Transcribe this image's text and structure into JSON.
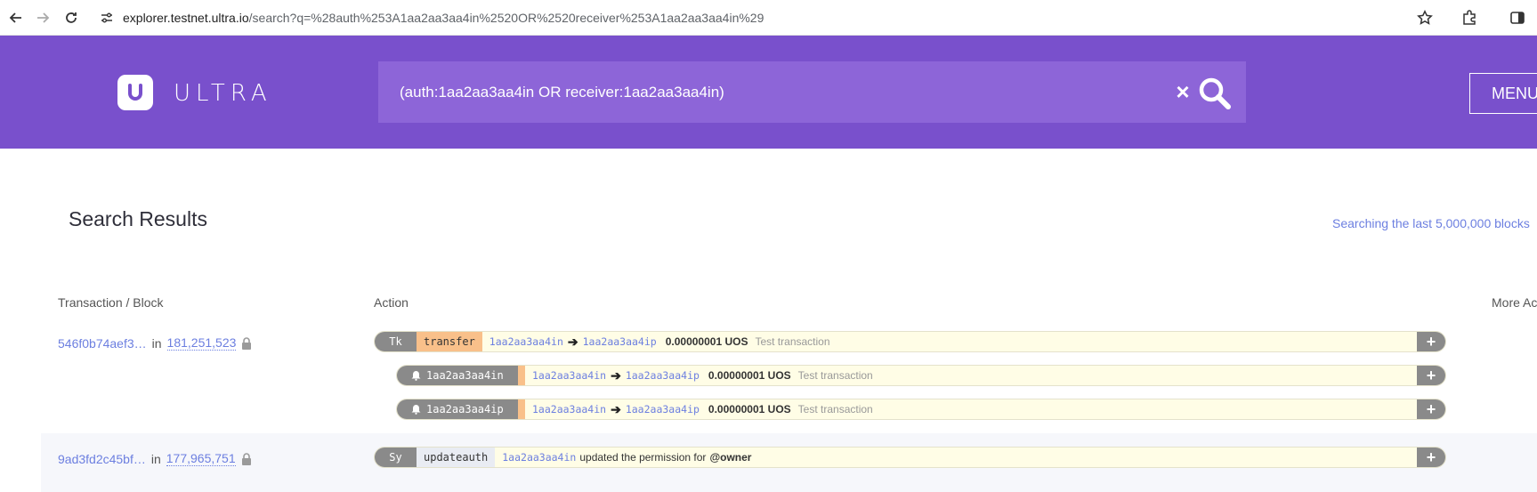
{
  "browser": {
    "url_host": "explorer.testnet.ultra.io",
    "url_path": "/search?q=%28auth%253A1aa2aa3aa4in%2520OR%2520receiver%253A1aa2aa3aa4in%29"
  },
  "header": {
    "logo_text": "ULTRA",
    "search_value": "(auth:1aa2aa3aa4in OR receiver:1aa2aa3aa4in)",
    "clear_symbol": "×",
    "menu_label": "MENU"
  },
  "results": {
    "title": "Search Results",
    "searching_text": "Searching the last 5,000,000 blocks",
    "columns": {
      "tx_block": "Transaction / Block",
      "action": "Action",
      "more": "More Ac"
    },
    "rows": [
      {
        "tx": "546f0b74aef3…",
        "in": "in",
        "block": "181,251,523",
        "actions": [
          {
            "code": "Tk",
            "name": "transfer",
            "from": "1aa2aa3aa4in",
            "to": "1aa2aa3aa4ip",
            "amount": "0.00000001 UOS",
            "memo": "Test transaction"
          },
          {
            "notify": "1aa2aa3aa4in",
            "from": "1aa2aa3aa4in",
            "to": "1aa2aa3aa4ip",
            "amount": "0.00000001 UOS",
            "memo": "Test transaction"
          },
          {
            "notify": "1aa2aa3aa4ip",
            "from": "1aa2aa3aa4in",
            "to": "1aa2aa3aa4ip",
            "amount": "0.00000001 UOS",
            "memo": "Test transaction"
          }
        ]
      },
      {
        "tx": "9ad3fd2c45bf…",
        "in": "in",
        "block": "177,965,751",
        "actions": [
          {
            "code": "Sy",
            "name": "updateauth",
            "account": "1aa2aa3aa4in",
            "text": "updated the permission for",
            "permission": "@owner"
          }
        ]
      }
    ],
    "plus_symbol": "+"
  }
}
